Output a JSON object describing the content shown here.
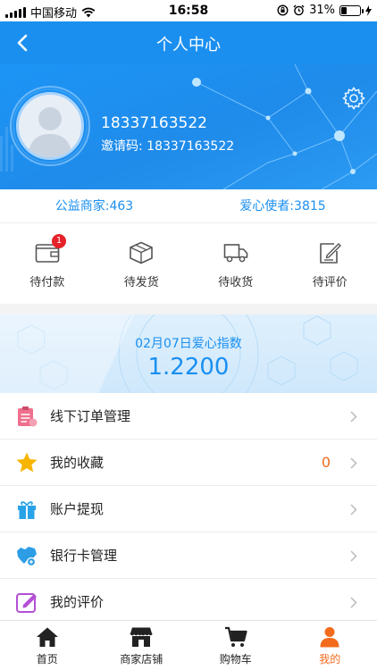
{
  "status_bar": {
    "carrier": "中国移动",
    "time": "16:58",
    "battery": "31%",
    "battery_level": 0.31
  },
  "nav": {
    "title": "个人中心"
  },
  "profile": {
    "phone": "18337163522",
    "invite_label": "邀请码:",
    "invite_code": "18337163522"
  },
  "stats": {
    "merchants_label": "公益商家:",
    "merchants_value": "463",
    "ambassadors_label": "爱心使者:",
    "ambassadors_value": "3815"
  },
  "orders": [
    {
      "label": "待付款",
      "badge": "1",
      "icon": "wallet-icon"
    },
    {
      "label": "待发货",
      "icon": "box-icon"
    },
    {
      "label": "待收货",
      "icon": "truck-icon"
    },
    {
      "label": "待评价",
      "icon": "edit-icon"
    }
  ],
  "love_index": {
    "label": "02月07日爱心指数",
    "value": "1.2200"
  },
  "menu": [
    {
      "label": "线下订单管理",
      "icon": "clipboard-icon",
      "color": "#ef6f8d"
    },
    {
      "label": "我的收藏",
      "value": "0",
      "icon": "star-icon",
      "color": "#f7b500"
    },
    {
      "label": "账户提现",
      "icon": "gift-icon",
      "color": "#29a3e8"
    },
    {
      "label": "银行卡管理",
      "icon": "bank-card-icon",
      "color": "#2d9de6"
    },
    {
      "label": "我的评价",
      "icon": "review-icon",
      "color": "#b34fd6"
    }
  ],
  "tabs": [
    {
      "label": "首页",
      "icon": "home-icon"
    },
    {
      "label": "商家店铺",
      "icon": "store-icon"
    },
    {
      "label": "购物车",
      "icon": "cart-icon"
    },
    {
      "label": "我的",
      "icon": "user-icon",
      "active": true
    }
  ],
  "colors": {
    "primary": "#1a8ff0",
    "accent": "#f26b1d",
    "badge": "#e62129"
  }
}
